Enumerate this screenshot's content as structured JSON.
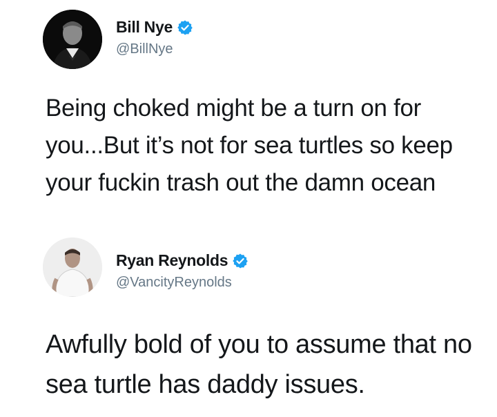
{
  "tweets": [
    {
      "display_name": "Bill Nye",
      "handle": "@BillNye",
      "verified": true,
      "avatar_icon": "person-photo-icon",
      "text": "Being choked might be a turn on for you...But it’s not for sea turtles so keep your fuckin trash out the damn ocean"
    },
    {
      "display_name": "Ryan Reynolds",
      "handle": "@VancityReynolds",
      "verified": true,
      "avatar_icon": "person-photo-icon",
      "text": "Awfully bold of you to assume that no sea turtle has daddy issues."
    }
  ],
  "colors": {
    "verified_badge": "#1da1f2",
    "handle_gray": "#657786",
    "text_dark": "#14171a",
    "background": "#ffffff"
  }
}
